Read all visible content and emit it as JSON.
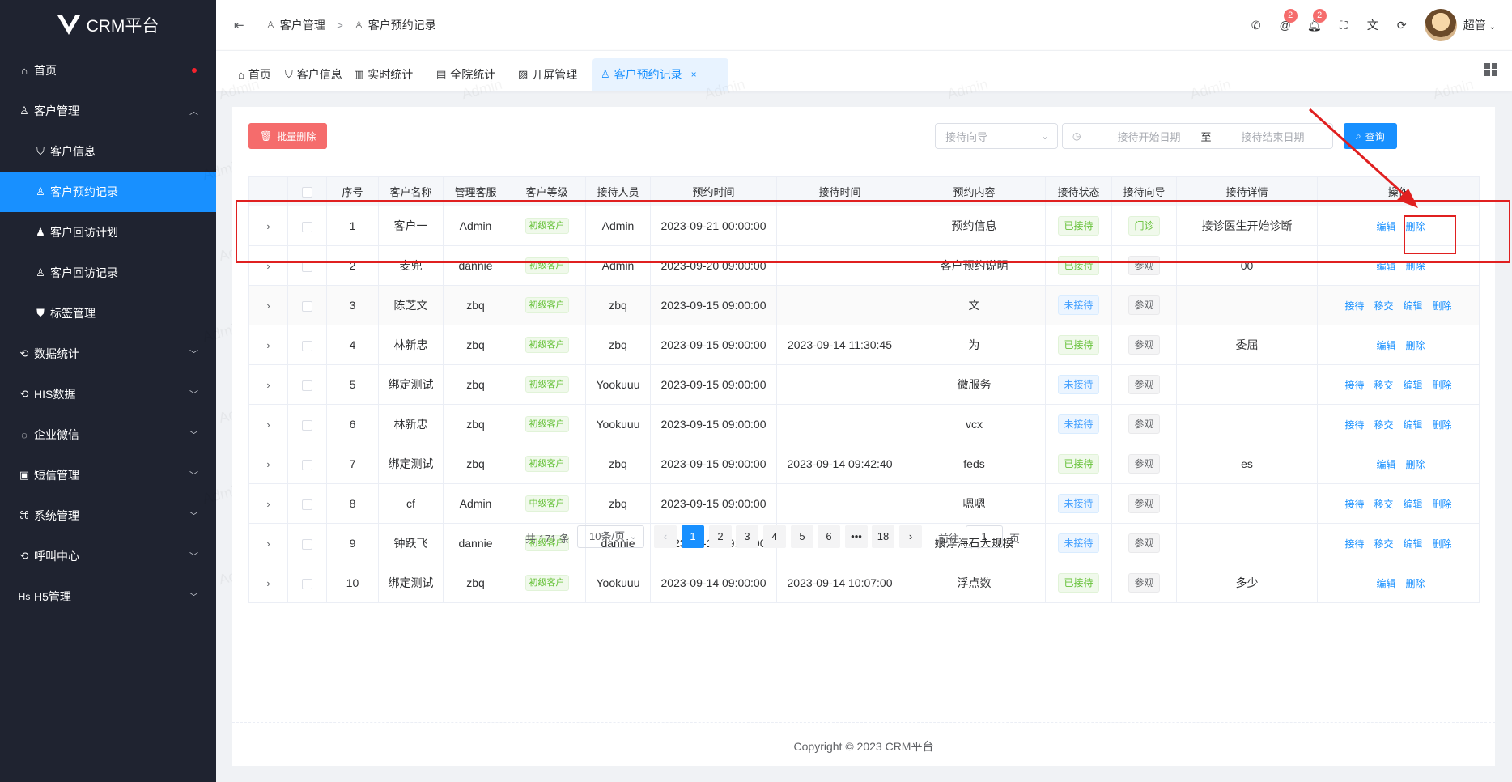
{
  "app": {
    "title": "CRM平台"
  },
  "sidebar": {
    "items": [
      {
        "label": "首页",
        "icon": "home-icon",
        "has_dot": true
      },
      {
        "label": "客户管理",
        "icon": "user-icon",
        "expanded": true
      },
      {
        "label": "客户信息",
        "icon": "shield-user-icon",
        "sub": true
      },
      {
        "label": "客户预约记录",
        "icon": "user-icon",
        "sub": true,
        "active": true
      },
      {
        "label": "客户回访计划",
        "icon": "user-filled-icon",
        "sub": true
      },
      {
        "label": "客户回访记录",
        "icon": "user-icon",
        "sub": true
      },
      {
        "label": "标签管理",
        "icon": "shield-check-icon",
        "sub": true
      },
      {
        "label": "数据统计",
        "icon": "refresh-icon"
      },
      {
        "label": "HIS数据",
        "icon": "refresh-icon"
      },
      {
        "label": "企业微信",
        "icon": "chat-icon"
      },
      {
        "label": "短信管理",
        "icon": "message-icon"
      },
      {
        "label": "系统管理",
        "icon": "command-icon"
      },
      {
        "label": "呼叫中心",
        "icon": "refresh-icon"
      },
      {
        "label": "H5管理",
        "icon": "hs-icon",
        "icon_text": "Hs"
      }
    ]
  },
  "header": {
    "breadcrumb": [
      "客户管理",
      "客户预约记录"
    ],
    "breadcrumb_sep": ">",
    "badges": {
      "mention": "2",
      "bell": "2"
    },
    "user_name": "超管"
  },
  "tabs": [
    {
      "label": "首页",
      "icon": "home-icon"
    },
    {
      "label": "客户信息",
      "icon": "shield-user-icon"
    },
    {
      "label": "实时统计",
      "icon": "chart-icon"
    },
    {
      "label": "全院统计",
      "icon": "document-icon"
    },
    {
      "label": "开屏管理",
      "icon": "image-icon"
    },
    {
      "label": "客户预约记录",
      "icon": "user-icon",
      "active": true,
      "closable": true
    }
  ],
  "toolbar": {
    "batch_delete": "批量删除",
    "guide_placeholder": "接待向导",
    "start_placeholder": "接待开始日期",
    "range_sep": "至",
    "end_placeholder": "接待结束日期",
    "query": "查询"
  },
  "table": {
    "headers": [
      "序号",
      "客户名称",
      "管理客服",
      "客户等级",
      "接待人员",
      "预约时间",
      "接待时间",
      "预约内容",
      "接待状态",
      "接待向导",
      "接待详情",
      "操作"
    ],
    "rows": [
      {
        "no": "1",
        "name": "客户一",
        "service": "Admin",
        "level": "初级客户",
        "staff": "Admin",
        "appt": "2023-09-21 00:00:00",
        "recv": "",
        "content": "预约信息",
        "status": "已接待",
        "guide": "门诊",
        "detail": "接诊医生开始诊断",
        "ops": [
          "编辑",
          "删除"
        ]
      },
      {
        "no": "2",
        "name": "麦兜",
        "service": "dannie",
        "level": "初级客户",
        "staff": "Admin",
        "appt": "2023-09-20 09:00:00",
        "recv": "",
        "content": "客户预约说明",
        "status": "已接待",
        "guide": "参观",
        "detail": "00",
        "ops": [
          "编辑",
          "删除"
        ]
      },
      {
        "no": "3",
        "name": "陈芝文",
        "service": "zbq",
        "level": "初级客户",
        "staff": "zbq",
        "appt": "2023-09-15 09:00:00",
        "recv": "",
        "content": "文",
        "status": "未接待",
        "guide": "参观",
        "detail": "",
        "ops": [
          "接待",
          "移交",
          "编辑",
          "删除"
        ]
      },
      {
        "no": "4",
        "name": "林新忠",
        "service": "zbq",
        "level": "初级客户",
        "staff": "zbq",
        "appt": "2023-09-15 09:00:00",
        "recv": "2023-09-14 11:30:45",
        "content": "为",
        "status": "已接待",
        "guide": "参观",
        "detail": "委屈",
        "ops": [
          "编辑",
          "删除"
        ]
      },
      {
        "no": "5",
        "name": "绑定测试",
        "service": "zbq",
        "level": "初级客户",
        "staff": "Yookuuu",
        "appt": "2023-09-15 09:00:00",
        "recv": "",
        "content": "微服务",
        "status": "未接待",
        "guide": "参观",
        "detail": "",
        "ops": [
          "接待",
          "移交",
          "编辑",
          "删除"
        ]
      },
      {
        "no": "6",
        "name": "林新忠",
        "service": "zbq",
        "level": "初级客户",
        "staff": "Yookuuu",
        "appt": "2023-09-15 09:00:00",
        "recv": "",
        "content": "vcx",
        "status": "未接待",
        "guide": "参观",
        "detail": "",
        "ops": [
          "接待",
          "移交",
          "编辑",
          "删除"
        ]
      },
      {
        "no": "7",
        "name": "绑定测试",
        "service": "zbq",
        "level": "初级客户",
        "staff": "zbq",
        "appt": "2023-09-15 09:00:00",
        "recv": "2023-09-14 09:42:40",
        "content": "feds",
        "status": "已接待",
        "guide": "参观",
        "detail": "es",
        "ops": [
          "编辑",
          "删除"
        ]
      },
      {
        "no": "8",
        "name": "cf",
        "service": "Admin",
        "level": "中级客户",
        "staff": "zbq",
        "appt": "2023-09-15 09:00:00",
        "recv": "",
        "content": "嗯嗯",
        "status": "未接待",
        "guide": "参观",
        "detail": "",
        "ops": [
          "接待",
          "移交",
          "编辑",
          "删除"
        ]
      },
      {
        "no": "9",
        "name": "钟跃飞",
        "service": "dannie",
        "level": "初级客户",
        "staff": "dannie",
        "appt": "2023-09-14 09:00:00",
        "recv": "",
        "content": "娘浮海石大规模",
        "status": "未接待",
        "guide": "参观",
        "detail": "",
        "ops": [
          "接待",
          "移交",
          "编辑",
          "删除"
        ]
      },
      {
        "no": "10",
        "name": "绑定测试",
        "service": "zbq",
        "level": "初级客户",
        "staff": "Yookuuu",
        "appt": "2023-09-14 09:00:00",
        "recv": "2023-09-14 10:07:00",
        "content": "浮点数",
        "status": "已接待",
        "guide": "参观",
        "detail": "多少",
        "ops": [
          "编辑",
          "删除"
        ]
      }
    ]
  },
  "pagination": {
    "total": "共 171 条",
    "page_size": "10条/页",
    "pages": [
      "1",
      "2",
      "3",
      "4",
      "5",
      "6",
      "•••",
      "18"
    ],
    "current": "1",
    "goto_label": "前往",
    "goto_value": "1",
    "goto_unit": "页"
  },
  "footer": {
    "copyright": "Copyright © 2023 CRM平台"
  },
  "watermark": "Admin",
  "colors": {
    "primary": "#1890ff",
    "danger": "#f56c6c",
    "sidebar": "#1f2330",
    "annotation": "#e02020"
  }
}
